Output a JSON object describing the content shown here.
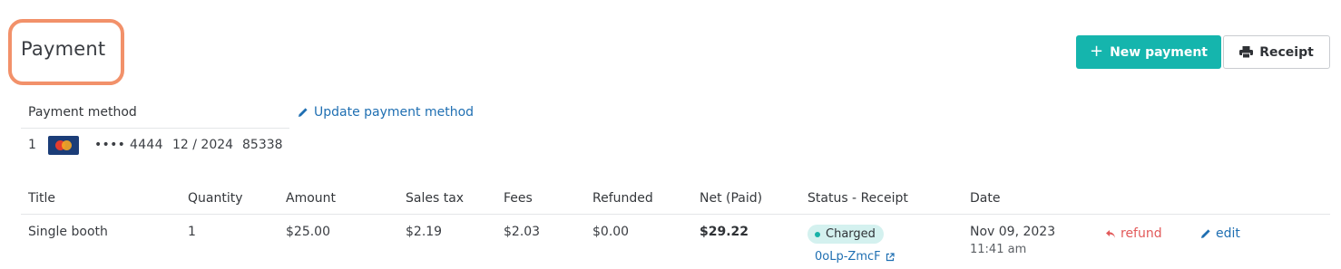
{
  "header": {
    "title": "Payment",
    "new_payment_label": "New payment",
    "receipt_label": "Receipt"
  },
  "payment_method": {
    "heading": "Payment method",
    "update_label": "Update payment method",
    "index": "1",
    "card_icon": "mastercard-icon",
    "last4": "•••• 4444",
    "expiry": "12 / 2024",
    "zip": "85338"
  },
  "table": {
    "columns": [
      "Title",
      "Quantity",
      "Amount",
      "Sales tax",
      "Fees",
      "Refunded",
      "Net (Paid)",
      "Status - Receipt",
      "Date"
    ],
    "rows": [
      {
        "title": "Single booth",
        "quantity": "1",
        "amount": "$25.00",
        "sales_tax": "$2.19",
        "fees": "$2.03",
        "refunded": "$0.00",
        "net_paid": "$29.22",
        "status": "Charged",
        "receipt_id": "0oLp-ZmcF",
        "date": "Nov 09, 2023",
        "time": "11:41 am",
        "refund_label": "refund",
        "edit_label": "edit"
      }
    ]
  },
  "colors": {
    "accent": "#15b5ad",
    "link": "#1f6fb2",
    "danger": "#e25a5a",
    "highlight": "#f2916a"
  }
}
